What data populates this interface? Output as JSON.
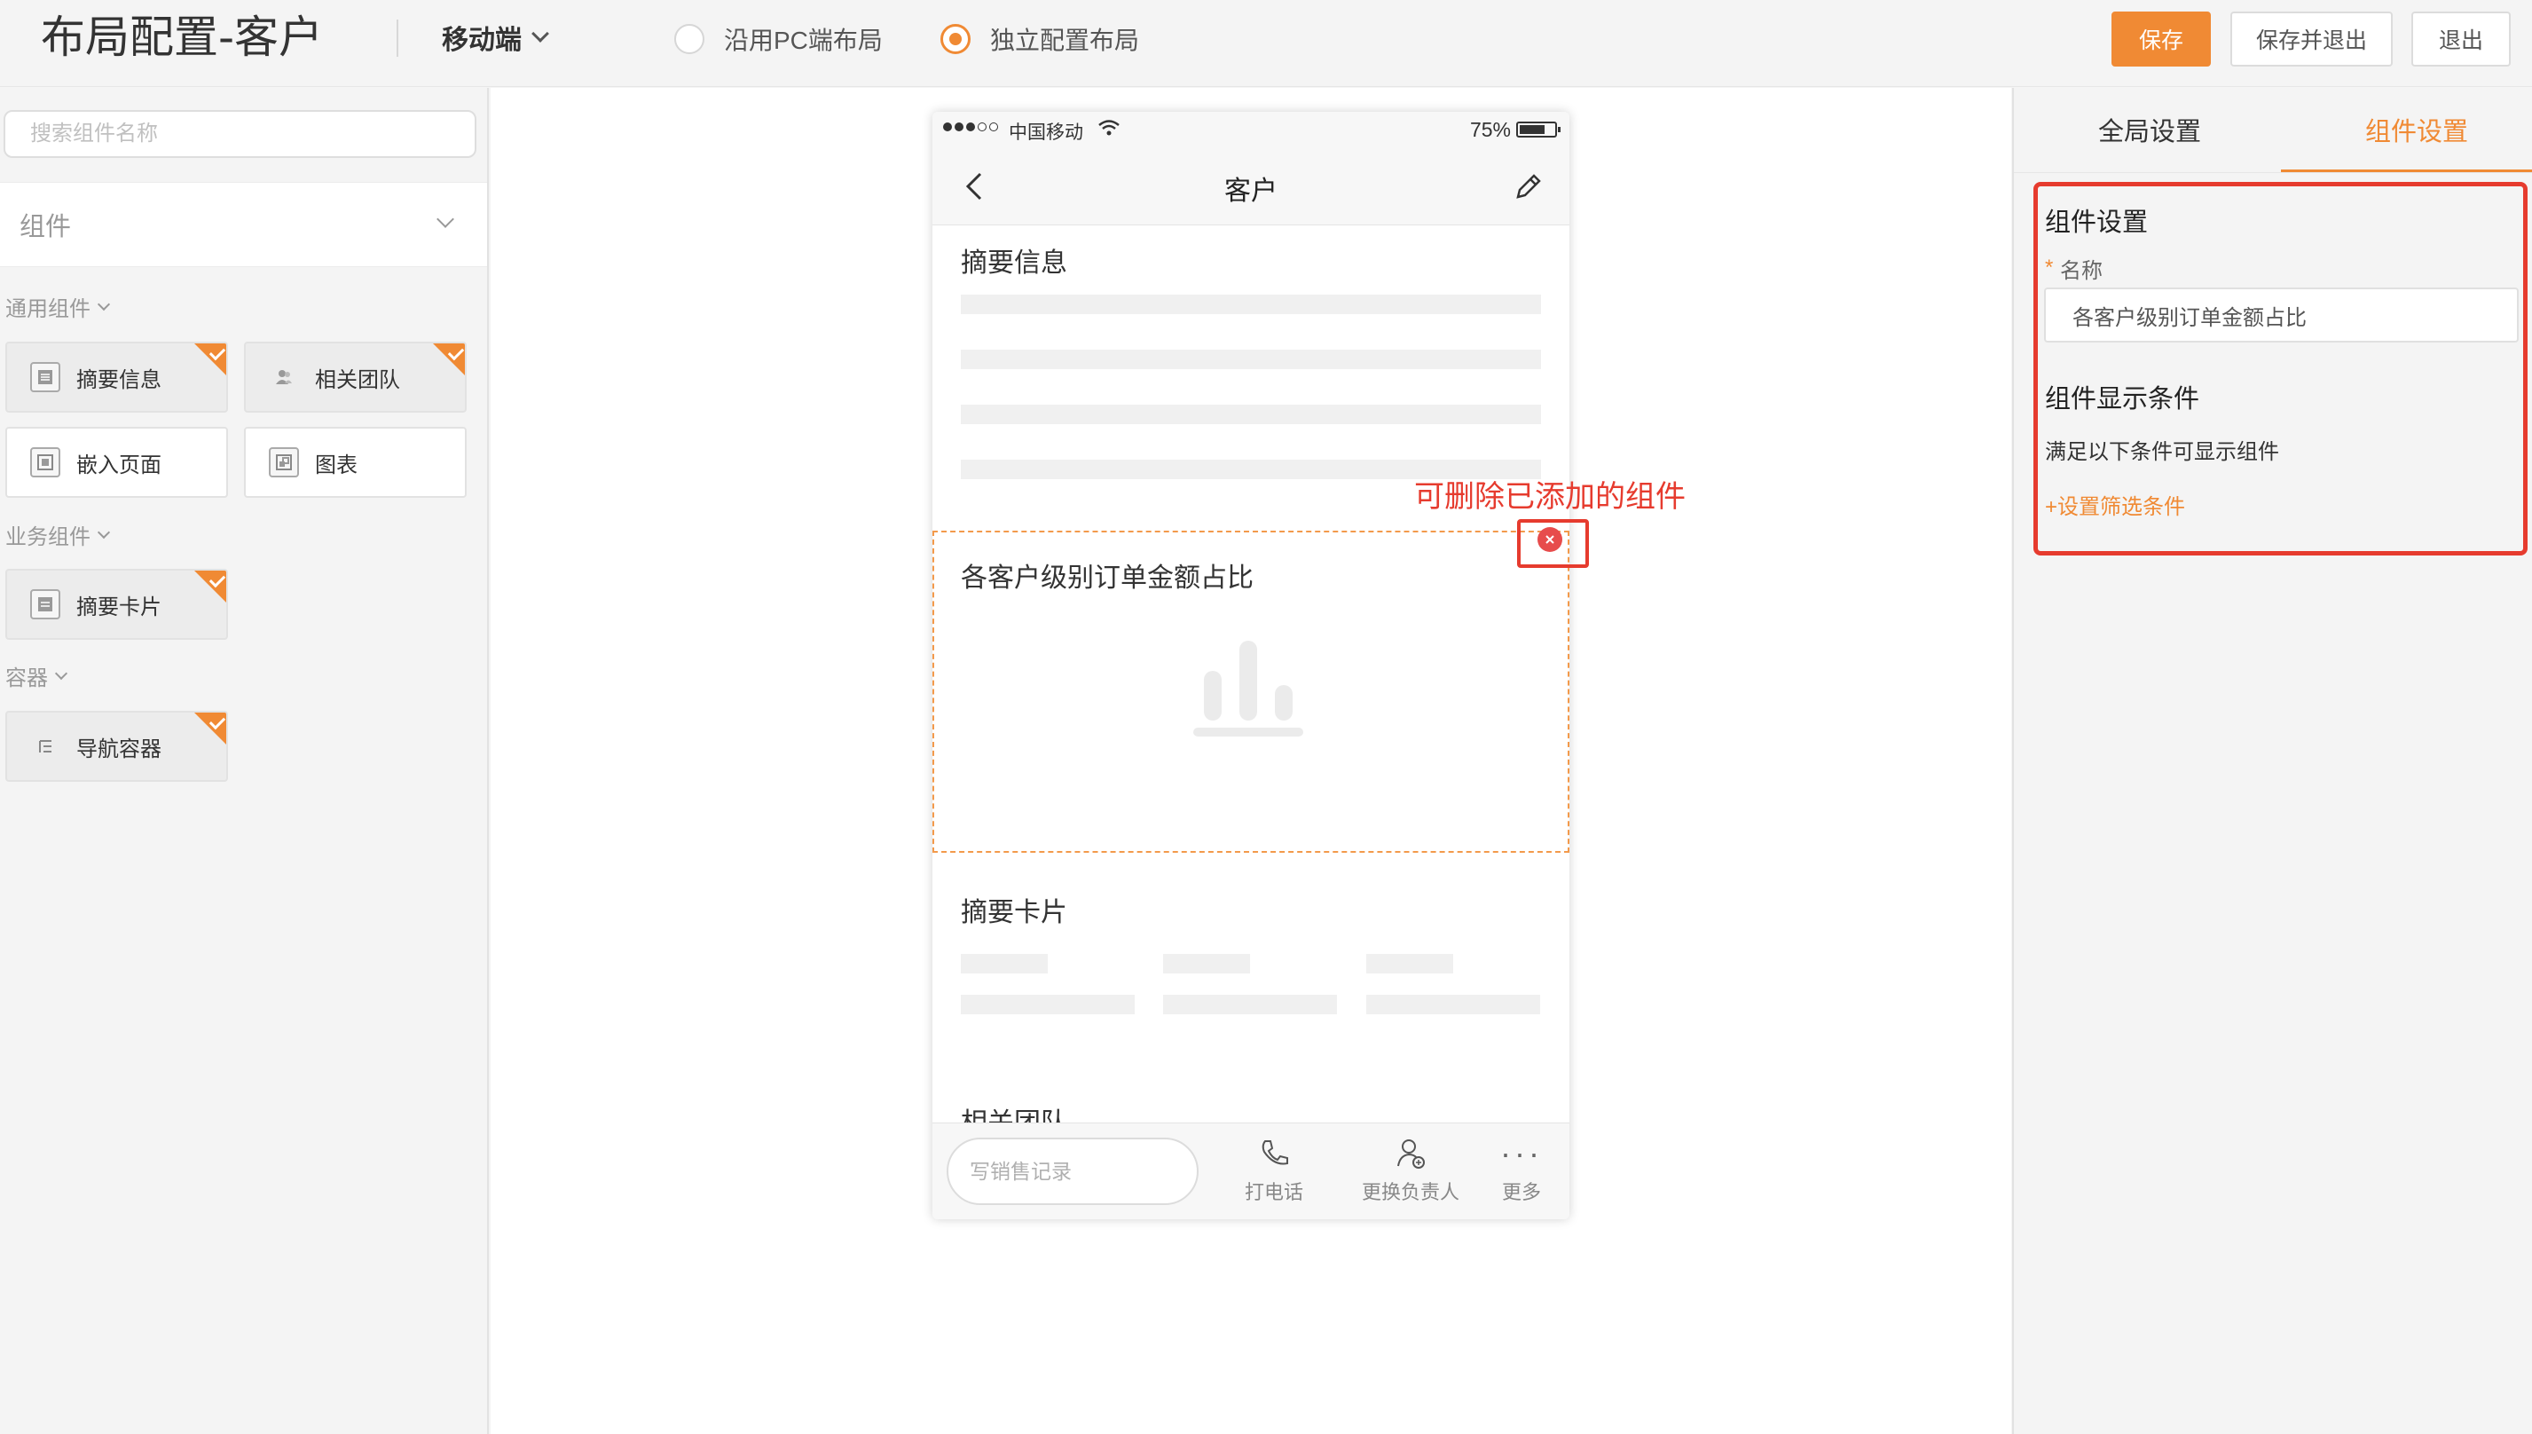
{
  "header": {
    "title": "布局配置-客户",
    "device": "移动端",
    "radio_options": [
      {
        "label": "沿用PC端布局",
        "checked": false
      },
      {
        "label": "独立配置布局",
        "checked": true
      }
    ],
    "buttons": {
      "save": "保存",
      "save_exit": "保存并退出",
      "exit": "退出"
    }
  },
  "sidebar": {
    "search_placeholder": "搜索组件名称",
    "group_label": "组件",
    "sections": [
      {
        "label": "通用组件",
        "items": [
          {
            "label": "摘要信息",
            "added": true,
            "icon": "summary-icon"
          },
          {
            "label": "相关团队",
            "added": true,
            "icon": "team-icon"
          },
          {
            "label": "嵌入页面",
            "added": false,
            "icon": "embed-page-icon"
          },
          {
            "label": "图表",
            "added": false,
            "icon": "chart-icon"
          }
        ]
      },
      {
        "label": "业务组件",
        "items": [
          {
            "label": "摘要卡片",
            "added": true,
            "icon": "summary-card-icon"
          }
        ]
      },
      {
        "label": "容器",
        "items": [
          {
            "label": "导航容器",
            "added": true,
            "icon": "nav-container-icon"
          }
        ]
      }
    ]
  },
  "phone": {
    "carrier": "中国移动",
    "battery": "75%",
    "nav_title": "客户",
    "sections": [
      "摘要信息",
      "各客户级别订单金额占比",
      "摘要卡片",
      "相关团队"
    ],
    "bottom": {
      "input_placeholder": "写销售记录",
      "actions": [
        "打电话",
        "更换负责人",
        "更多"
      ]
    }
  },
  "annotation": {
    "text": "可删除已添加的组件",
    "color": "#e63b2e"
  },
  "right_panel": {
    "tabs": [
      {
        "label": "全局设置",
        "active": false
      },
      {
        "label": "组件设置",
        "active": true
      }
    ],
    "heading": "组件设置",
    "name_label": "名称",
    "name_value": "各客户级别订单金额占比",
    "condition_heading": "组件显示条件",
    "condition_desc": "满足以下条件可显示组件",
    "condition_link": "+设置筛选条件"
  },
  "colors": {
    "accent": "#f08a34",
    "annotation": "#e63b2e",
    "delete": "#e74c4c"
  }
}
